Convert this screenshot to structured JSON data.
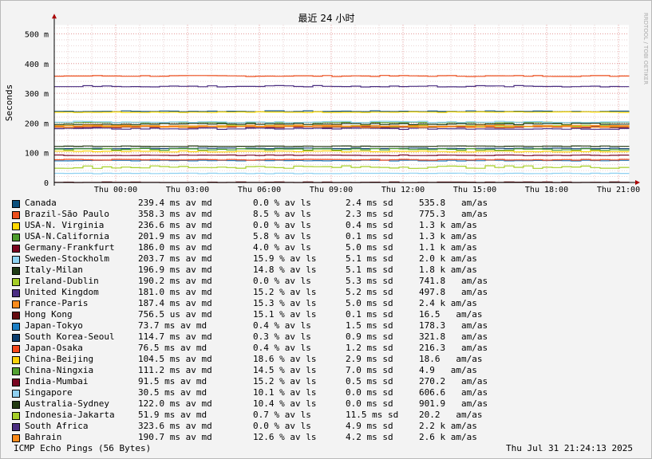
{
  "chart_data": {
    "type": "line",
    "title": "最近 24 小时",
    "ylabel": "Seconds",
    "watermark": "RRDTOOL / TOBI OETIKER",
    "ylim": [
      0,
      0.53
    ],
    "y_ticks": [
      {
        "value": 0,
        "label": "0"
      },
      {
        "value": 0.1,
        "label": "100 m"
      },
      {
        "value": 0.2,
        "label": "200 m"
      },
      {
        "value": 0.3,
        "label": "300 m"
      },
      {
        "value": 0.4,
        "label": "400 m"
      },
      {
        "value": 0.5,
        "label": "500 m"
      }
    ],
    "x_ticks": [
      "Thu 00:00",
      "Thu 03:00",
      "Thu 06:00",
      "Thu 09:00",
      "Thu 12:00",
      "Thu 15:00",
      "Thu 18:00",
      "Thu 21:00"
    ],
    "grid": true,
    "series": [
      {
        "name": "Canada",
        "color": "#0a4f7c",
        "avg": 0.2394,
        "avg_text": "239.4 ms av md",
        "loss": "0.0 % av ls",
        "sd": "2.4 ms sd",
        "ams": "535.8   am/as"
      },
      {
        "name": "Brazil-São Paulo",
        "color": "#ec4f1e",
        "avg": 0.3583,
        "avg_text": "358.3 ms av md",
        "loss": "8.5 % av ls",
        "sd": "2.3 ms sd",
        "ams": "775.3   am/as"
      },
      {
        "name": "USA-N. Virginia",
        "color": "#ffd800",
        "avg": 0.2366,
        "avg_text": "236.6 ms av md",
        "loss": "0.0 % av ls",
        "sd": "0.4 ms sd",
        "ams": "1.3 k am/as"
      },
      {
        "name": "USA-N.California",
        "color": "#4e9d2e",
        "avg": 0.2019,
        "avg_text": "201.9 ms av md",
        "loss": "5.8 % av ls",
        "sd": "0.1 ms sd",
        "ams": "1.3 k am/as"
      },
      {
        "name": "Germany-Frankfurt",
        "color": "#7b0520",
        "avg": 0.186,
        "avg_text": "186.0 ms av md",
        "loss": "4.0 % av ls",
        "sd": "5.0 ms sd",
        "ams": "1.1 k am/as"
      },
      {
        "name": "Sweden-Stockholm",
        "color": "#8ed3f2",
        "avg": 0.2037,
        "avg_text": "203.7 ms av md",
        "loss": "15.9 % av ls",
        "sd": "5.1 ms sd",
        "ams": "2.0 k am/as"
      },
      {
        "name": "Italy-Milan",
        "color": "#1f3b16",
        "avg": 0.1969,
        "avg_text": "196.9 ms av md",
        "loss": "14.8 % av ls",
        "sd": "5.1 ms sd",
        "ams": "1.8 k am/as"
      },
      {
        "name": "Ireland-Dublin",
        "color": "#a4cd25",
        "avg": 0.1902,
        "avg_text": "190.2 ms av md",
        "loss": "0.0 % av ls",
        "sd": "5.3 ms sd",
        "ams": "741.8   am/as"
      },
      {
        "name": "United Kingdom",
        "color": "#4b2e83",
        "avg": 0.181,
        "avg_text": "181.0 ms av md",
        "loss": "15.2 % av ls",
        "sd": "5.2 ms sd",
        "ams": "497.8   am/as"
      },
      {
        "name": "France-Paris",
        "color": "#fb8c1c",
        "avg": 0.1874,
        "avg_text": "187.4 ms av md",
        "loss": "15.3 % av ls",
        "sd": "5.0 ms sd",
        "ams": "2.4 k am/as"
      },
      {
        "name": "Hong Kong",
        "color": "#650a0f",
        "avg": 0.0007565,
        "avg_text": "756.5 us av md",
        "loss": "15.1 % av ls",
        "sd": "0.1 ms sd",
        "ams": "16.5   am/as"
      },
      {
        "name": "Japan-Tokyo",
        "color": "#1c7fc4",
        "avg": 0.0737,
        "avg_text": "73.7 ms av md",
        "loss": "0.4 % av ls",
        "sd": "1.5 ms sd",
        "ams": "178.3   am/as"
      },
      {
        "name": "South Korea-Seoul",
        "color": "#0b3d6e",
        "avg": 0.1147,
        "avg_text": "114.7 ms av md",
        "loss": "0.3 % av ls",
        "sd": "0.9 ms sd",
        "ams": "321.8   am/as"
      },
      {
        "name": "Japan-Osaka",
        "color": "#f5491d",
        "avg": 0.0765,
        "avg_text": "76.5 ms av md",
        "loss": "0.4 % av ls",
        "sd": "1.2 ms sd",
        "ams": "216.3   am/as"
      },
      {
        "name": "China-Beijing",
        "color": "#fad20c",
        "avg": 0.1045,
        "avg_text": "104.5 ms av md",
        "loss": "18.6 % av ls",
        "sd": "2.9 ms sd",
        "ams": "18.6   am/as"
      },
      {
        "name": "China-Ningxia",
        "color": "#53a132",
        "avg": 0.1112,
        "avg_text": "111.2 ms av md",
        "loss": "14.5 % av ls",
        "sd": "7.0 ms sd",
        "ams": "4.9   am/as"
      },
      {
        "name": "India-Mumbai",
        "color": "#7a0622",
        "avg": 0.0915,
        "avg_text": "91.5 ms av md",
        "loss": "15.2 % av ls",
        "sd": "0.5 ms sd",
        "ams": "270.2   am/as"
      },
      {
        "name": "Singapore",
        "color": "#8fd0f0",
        "avg": 0.0305,
        "avg_text": "30.5 ms av md",
        "loss": "10.1 % av ls",
        "sd": "0.0 ms sd",
        "ams": "606.6   am/as"
      },
      {
        "name": "Australia-Sydney",
        "color": "#223a12",
        "avg": 0.122,
        "avg_text": "122.0 ms av md",
        "loss": "10.4 % av ls",
        "sd": "0.0 ms sd",
        "ams": "901.9   am/as"
      },
      {
        "name": "Indonesia-Jakarta",
        "color": "#a6cf28",
        "avg": 0.0519,
        "avg_text": "51.9 ms av md",
        "loss": "0.7 % av ls",
        "sd": "11.5 ms sd",
        "ams": "20.2   am/as"
      },
      {
        "name": "South Africa",
        "color": "#4a2d80",
        "avg": 0.3236,
        "avg_text": "323.6 ms av md",
        "loss": "0.0 % av ls",
        "sd": "4.9 ms sd",
        "ams": "2.2 k am/as"
      },
      {
        "name": "Bahrain",
        "color": "#fa8a1a",
        "avg": 0.1907,
        "avg_text": "190.7 ms av md",
        "loss": "12.6 % av ls",
        "sd": "4.2 ms sd",
        "ams": "2.6 k am/as"
      }
    ]
  },
  "footer": {
    "left": "ICMP Echo Pings (56 Bytes)",
    "right": "Thu Jul 31 21:24:13 2025"
  }
}
